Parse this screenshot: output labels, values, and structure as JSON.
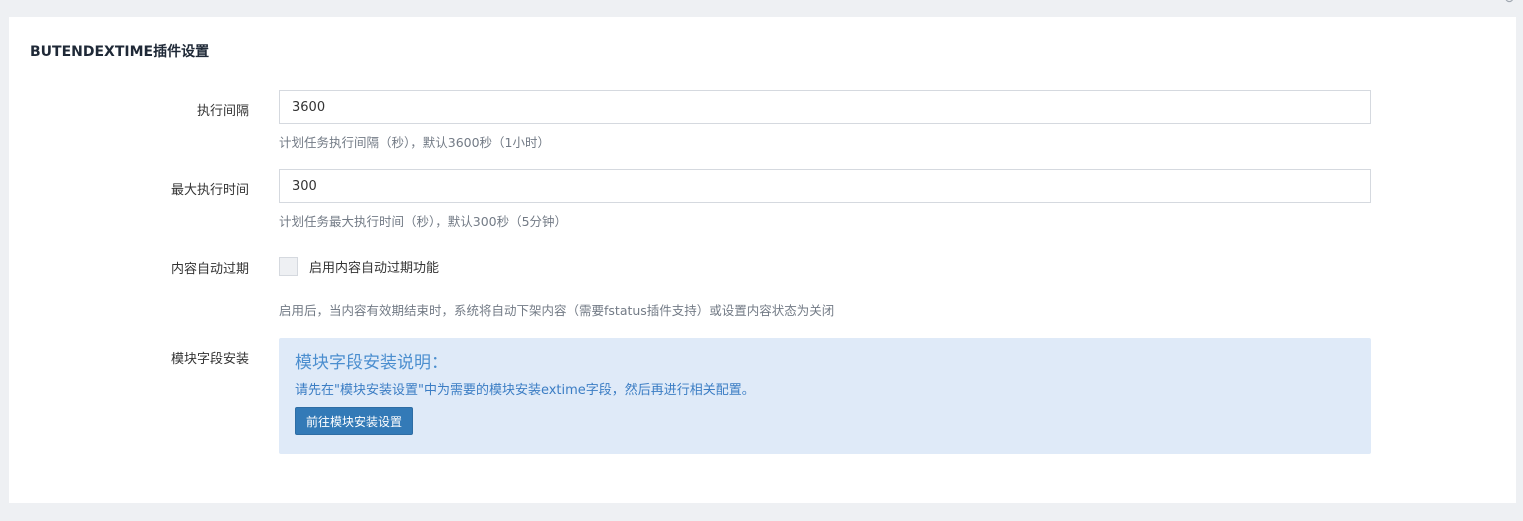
{
  "panel": {
    "title": "BUTENDEXTIME插件设置"
  },
  "fields": {
    "interval": {
      "label": "执行间隔",
      "value": "3600",
      "help": "计划任务执行间隔（秒），默认3600秒（1小时）"
    },
    "max_time": {
      "label": "最大执行时间",
      "value": "300",
      "help": "计划任务最大执行时间（秒），默认300秒（5分钟）"
    },
    "auto_expire": {
      "label": "内容自动过期",
      "checkbox_label": "启用内容自动过期功能",
      "checked": false,
      "help": "启用后，当内容有效期结束时，系统将自动下架内容（需要fstatus插件支持）或设置内容状态为关闭"
    },
    "module_install": {
      "label": "模块字段安装",
      "info_title": "模块字段安装说明：",
      "info_text": "请先在\"模块安装设置\"中为需要的模块安装extime字段，然后再进行相关配置。",
      "button_label": "前往模块安装设置"
    }
  },
  "icons": {
    "refresh": "refresh-icon"
  },
  "colors": {
    "primary": "#337ab7",
    "info_bg": "#dfeaf8",
    "info_title": "#4b8ecf",
    "page_bg": "#eef0f3"
  }
}
